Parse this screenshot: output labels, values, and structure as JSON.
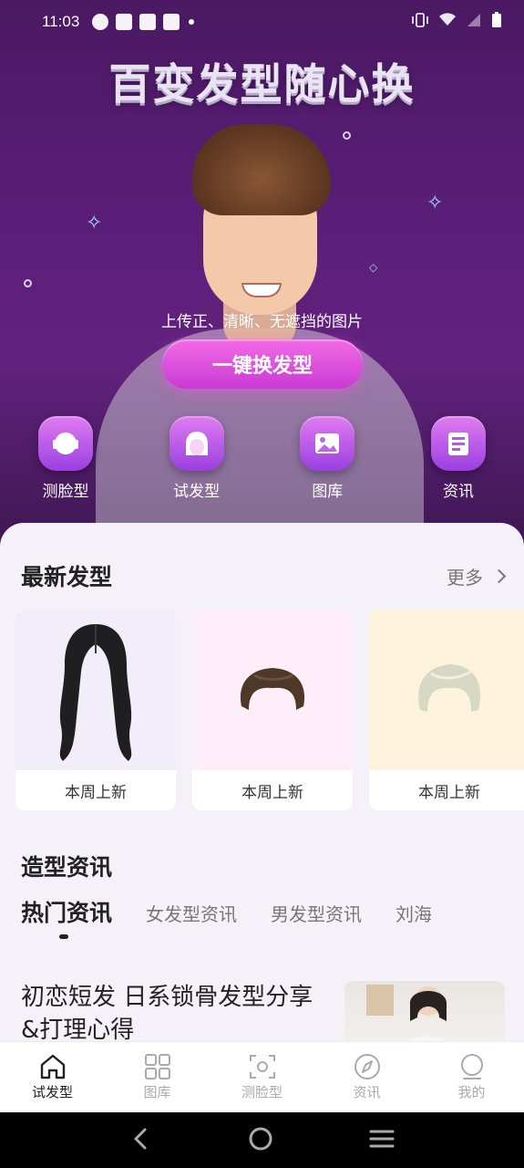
{
  "status_bar": {
    "time": "11:03",
    "notification_icons": [
      "speed-icon",
      "mail-icon",
      "mail-icon",
      "mail-icon"
    ],
    "right_icons": [
      "vibrate-icon",
      "wifi-icon",
      "signal-icon",
      "battery-icon"
    ]
  },
  "hero": {
    "title": "百变发型随心换",
    "hint": "上传正、清晰、无遮挡的图片",
    "cta_label": "一键换发型",
    "quick_actions": [
      {
        "label": "测脸型",
        "icon": "face-shape-icon"
      },
      {
        "label": "试发型",
        "icon": "hair-try-icon"
      },
      {
        "label": "图库",
        "icon": "gallery-icon"
      },
      {
        "label": "资讯",
        "icon": "news-icon"
      }
    ]
  },
  "latest": {
    "title": "最新发型",
    "more_label": "更多",
    "cards": [
      {
        "label": "本周上新",
        "bg": "#f1eef9",
        "hair": "long-black-wavy"
      },
      {
        "label": "本周上新",
        "bg": "#fdeefa",
        "hair": "short-brown"
      },
      {
        "label": "本周上新",
        "bg": "#fdf3dc",
        "hair": "short-blonde"
      }
    ]
  },
  "news": {
    "title": "造型资讯",
    "tabs": [
      "热门资讯",
      "女发型资讯",
      "男发型资讯",
      "刘海"
    ],
    "active_tab": 0,
    "article_title": "初恋短发 日系锁骨发型分享&打理心得"
  },
  "bottom_nav": {
    "items": [
      {
        "label": "试发型",
        "icon": "home-icon",
        "active": true
      },
      {
        "label": "图库",
        "icon": "grid-icon",
        "active": false
      },
      {
        "label": "测脸型",
        "icon": "scan-icon",
        "active": false
      },
      {
        "label": "资讯",
        "icon": "compass-icon",
        "active": false
      },
      {
        "label": "我的",
        "icon": "profile-icon",
        "active": false
      }
    ]
  },
  "system_nav": [
    "back-icon",
    "home-circle-icon",
    "menu-icon"
  ],
  "colors": {
    "accent": "#d94ee0",
    "hero_bg": "#5a1e78",
    "page_bg": "#f4f2f8"
  }
}
